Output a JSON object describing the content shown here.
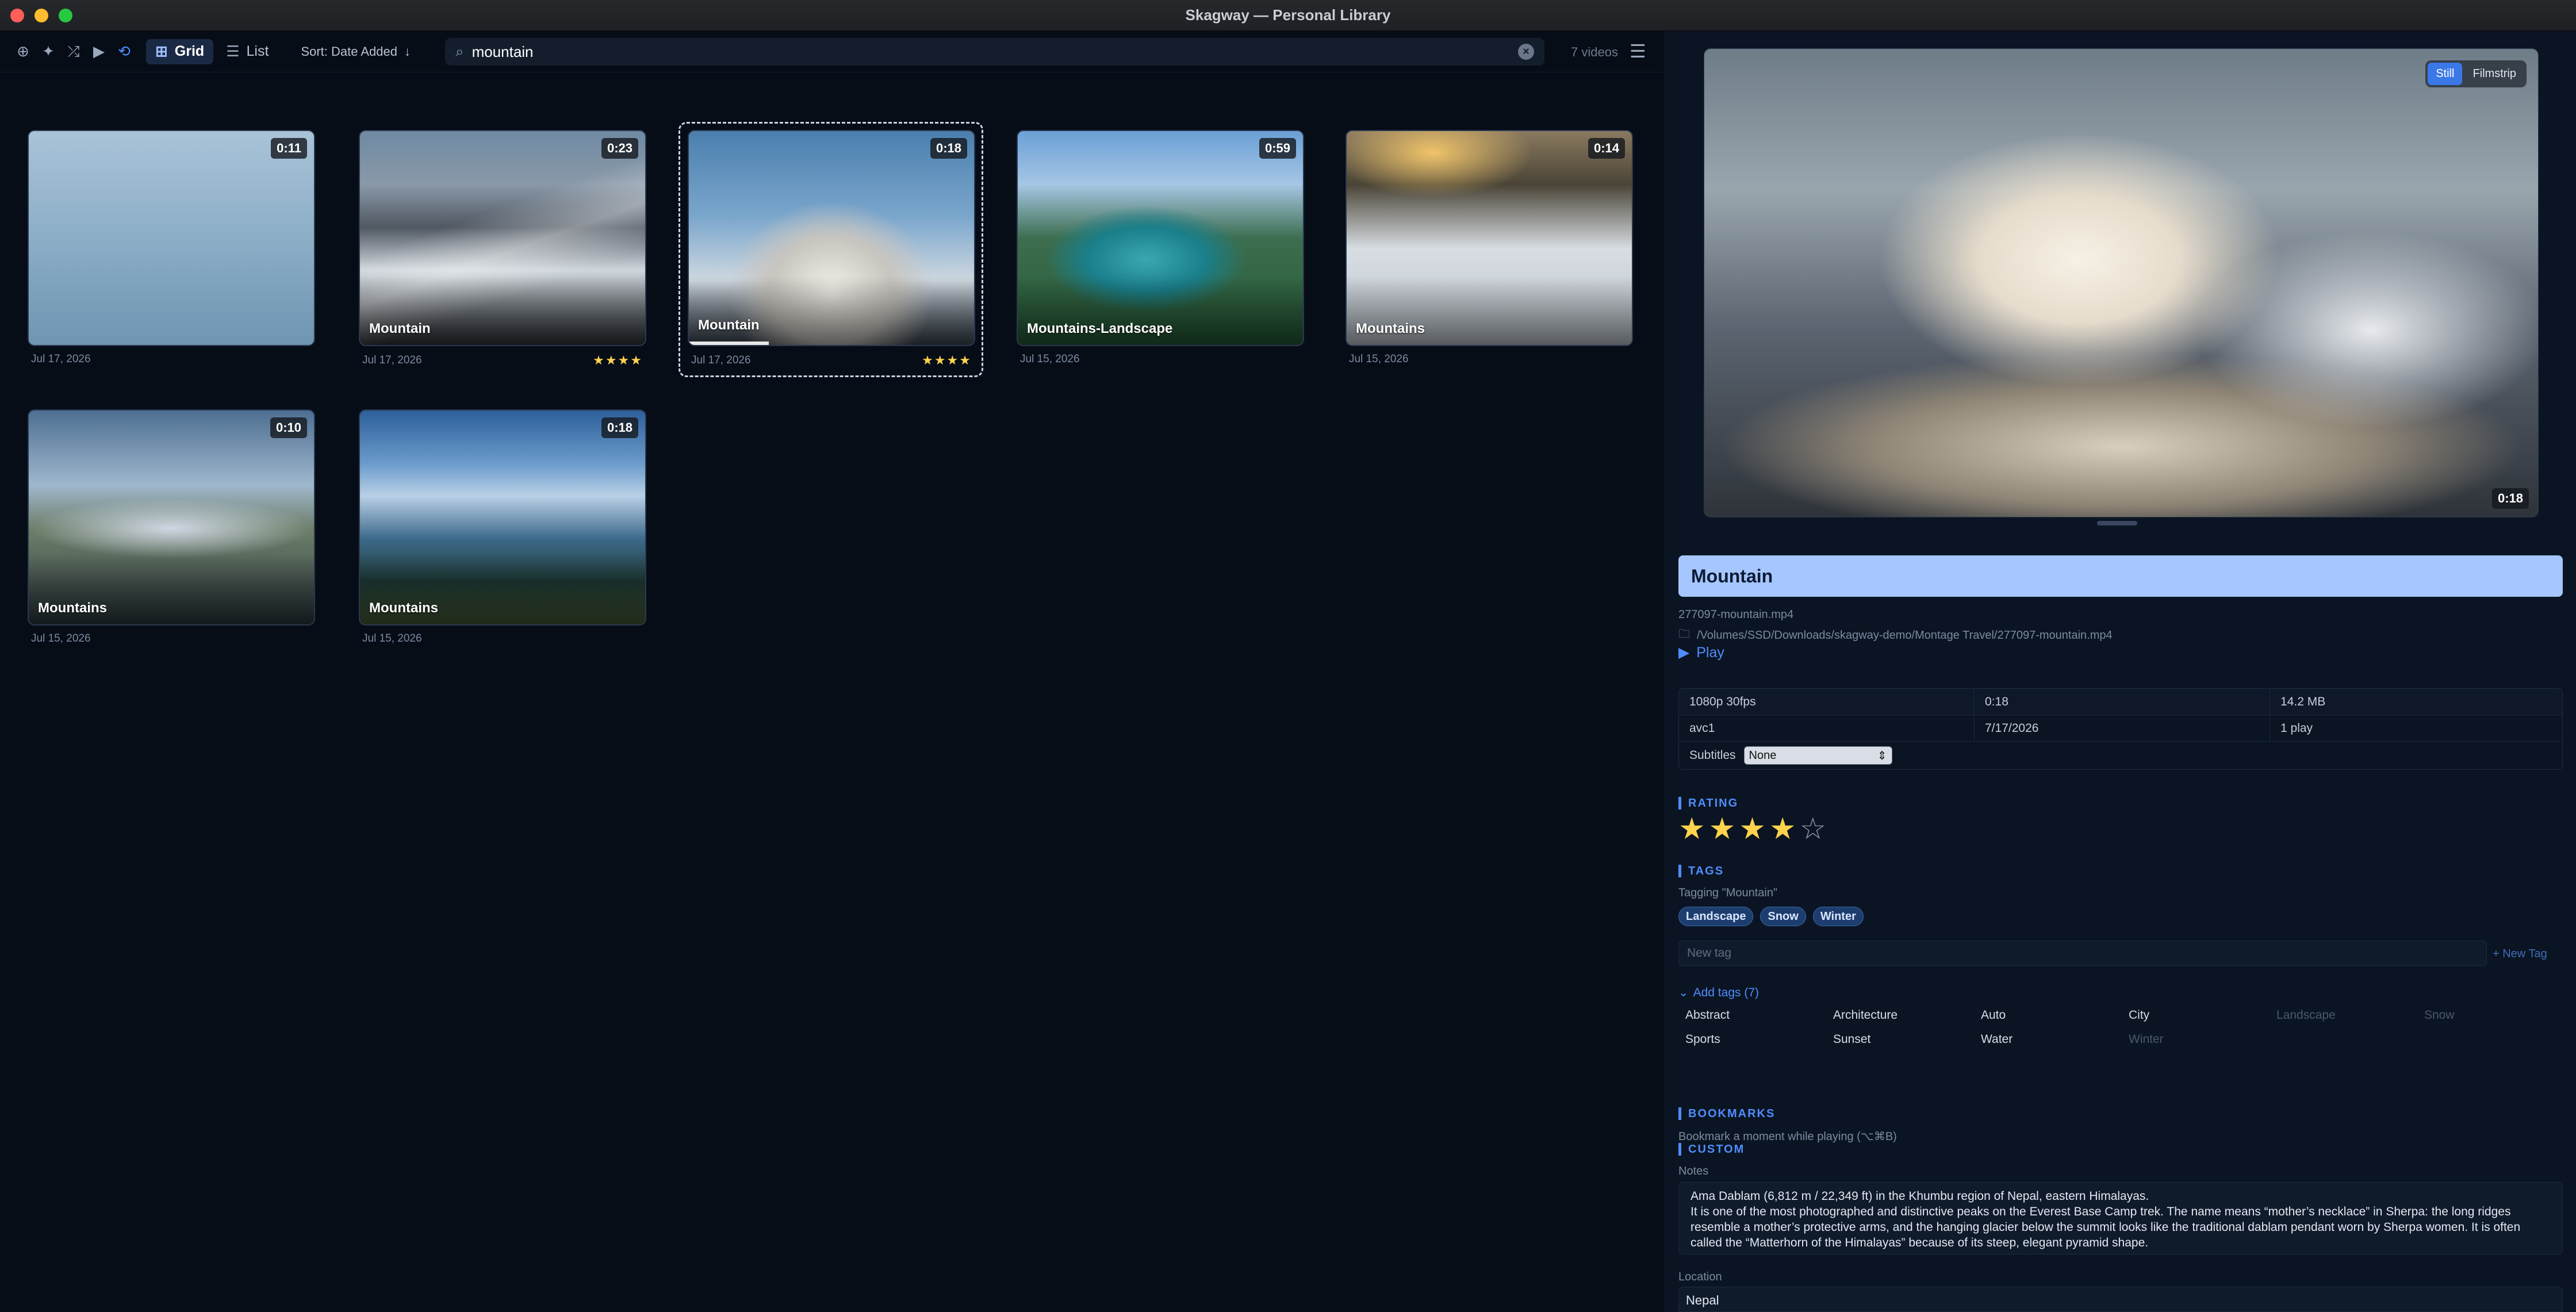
{
  "window": {
    "title": "Skagway — Personal Library"
  },
  "toolbar": {
    "grid_label": "Grid",
    "list_label": "List",
    "sort_label": "Sort: Date Added",
    "search_value": "mountain",
    "video_count": "7 videos"
  },
  "videos": [
    {
      "duration": "0:11",
      "title": "",
      "date": "Jul 17, 2026",
      "stars": ""
    },
    {
      "duration": "0:23",
      "title": "Mountain",
      "date": "Jul 17, 2026",
      "stars": "★★★★"
    },
    {
      "duration": "0:18",
      "title": "Mountain",
      "date": "Jul 17, 2026",
      "stars": "★★★★",
      "selected": true,
      "progress": 0.28
    },
    {
      "duration": "0:59",
      "title": "Mountains-Landscape",
      "date": "Jul 15, 2026",
      "stars": ""
    },
    {
      "duration": "0:14",
      "title": "Mountains",
      "date": "Jul 15, 2026",
      "stars": ""
    },
    {
      "duration": "0:10",
      "title": "Mountains",
      "date": "Jul 15, 2026",
      "stars": ""
    },
    {
      "duration": "0:18",
      "title": "Mountains",
      "date": "Jul 15, 2026",
      "stars": ""
    }
  ],
  "detail": {
    "preview": {
      "still_label": "Still",
      "filmstrip_label": "Filmstrip",
      "duration": "0:18"
    },
    "title": "Mountain",
    "filename": "277097-mountain.mp4",
    "path": "/Volumes/SSD/Downloads/skagway-demo/Montage Travel/277097-mountain.mp4",
    "play_label": "Play",
    "specs": {
      "resolution": "1080p 30fps",
      "duration": "0:18",
      "size": "14.2 MB",
      "codec": "avc1",
      "date": "7/17/2026",
      "plays": "1 play",
      "subtitles_label": "Subtitles",
      "subtitles_value": "None"
    },
    "rating": {
      "header": "RATING",
      "value": 4,
      "max": 5
    },
    "tags": {
      "header": "TAGS",
      "tagging_text": "Tagging \"Mountain\"",
      "applied": [
        "Landscape",
        "Snow",
        "Winter"
      ],
      "new_tag_placeholder": "New tag",
      "new_tag_button": "+ New Tag",
      "add_tags_label": "Add tags (7)",
      "available": [
        {
          "name": "Abstract",
          "used": false
        },
        {
          "name": "Architecture",
          "used": false
        },
        {
          "name": "Auto",
          "used": false
        },
        {
          "name": "City",
          "used": false
        },
        {
          "name": "Landscape",
          "used": true
        },
        {
          "name": "Snow",
          "used": true
        },
        {
          "name": "Sports",
          "used": false
        },
        {
          "name": "Sunset",
          "used": false
        },
        {
          "name": "Water",
          "used": false
        },
        {
          "name": "Winter",
          "used": true
        }
      ]
    },
    "bookmarks": {
      "header": "BOOKMARKS",
      "hint": "Bookmark a moment while playing (⌥⌘B)"
    },
    "custom": {
      "header": "CUSTOM",
      "notes_label": "Notes",
      "notes": "Ama Dablam (6,812 m / 22,349 ft) in the Khumbu region of Nepal, eastern Himalayas.\nIt is one of the most photographed and distinctive peaks on the Everest Base Camp trek. The name means “mother’s necklace” in Sherpa: the long ridges resemble a mother’s protective arms, and the hanging glacier below the summit looks like the traditional dablam pendant worn by Sherpa women. It is often called the “Matterhorn of the Himalayas” because of its steep, elegant pyramid shape.",
      "location_label": "Location",
      "location": "Nepal"
    }
  }
}
